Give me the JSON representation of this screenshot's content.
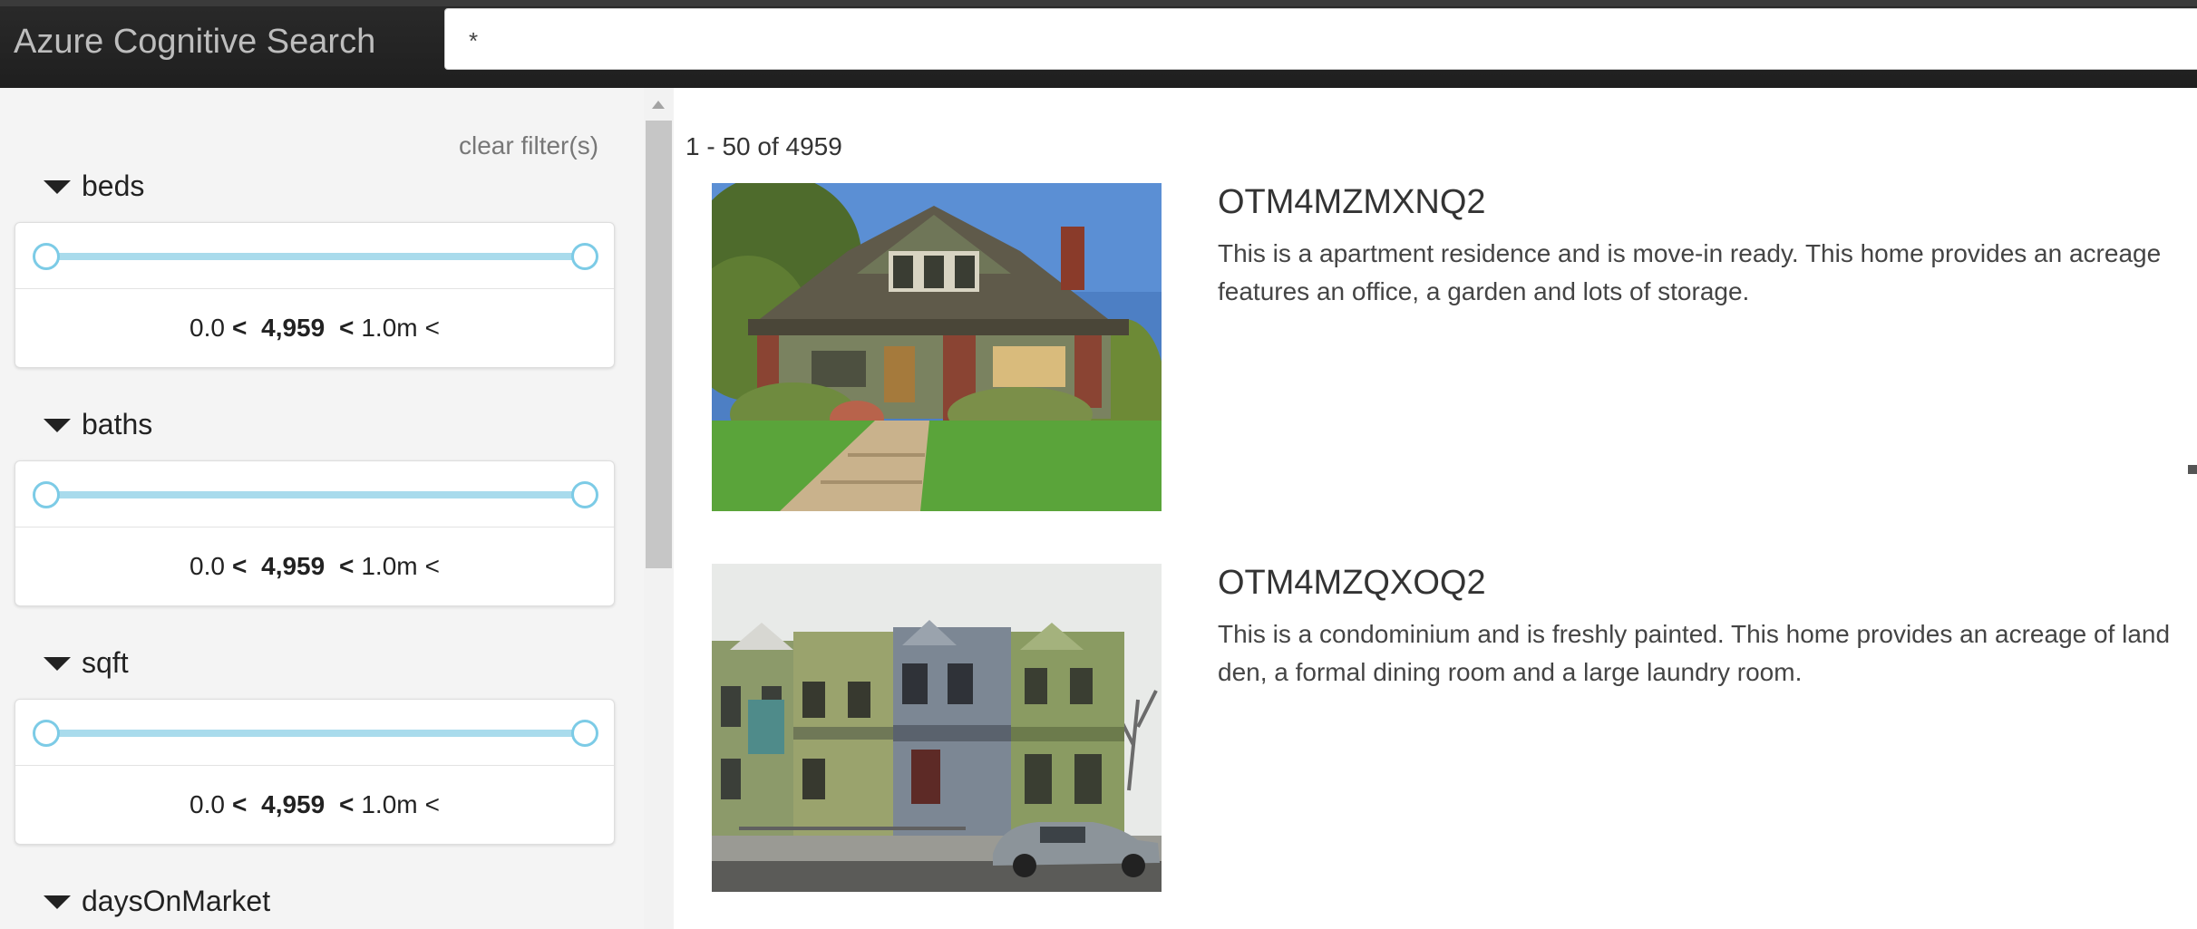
{
  "app": {
    "title": "Azure Cognitive Search"
  },
  "search": {
    "query": "*"
  },
  "sidebar": {
    "clear_filters_label": "clear filter(s)",
    "facets": [
      {
        "name": "beds",
        "min": "0.0",
        "count": "4,959",
        "max": "1.0m"
      },
      {
        "name": "baths",
        "min": "0.0",
        "count": "4,959",
        "max": "1.0m"
      },
      {
        "name": "sqft",
        "min": "0.0",
        "count": "4,959",
        "max": "1.0m"
      },
      {
        "name": "daysOnMarket"
      }
    ],
    "range_separator": "<"
  },
  "results": {
    "count_label": "1 - 50 of 4959",
    "items": [
      {
        "title": "OTM4MZMXNQ2",
        "desc_line1": "This is a apartment residence and is move-in ready. This home provides an acreage",
        "desc_line2": "features an office, a garden and lots of storage.",
        "image": "craftsman-house-photo"
      },
      {
        "title": "OTM4MZQXOQ2",
        "desc_line1": "This is a condominium and is freshly painted. This home provides an acreage of land",
        "desc_line2": "den, a formal dining room and a large laundry room.",
        "image": "row-houses-photo"
      }
    ]
  },
  "colors": {
    "topbar": "#222222",
    "slider_track": "#a9dbec",
    "slider_handle_border": "#7ccbe6",
    "sidebar_bg": "#f4f4f4"
  }
}
